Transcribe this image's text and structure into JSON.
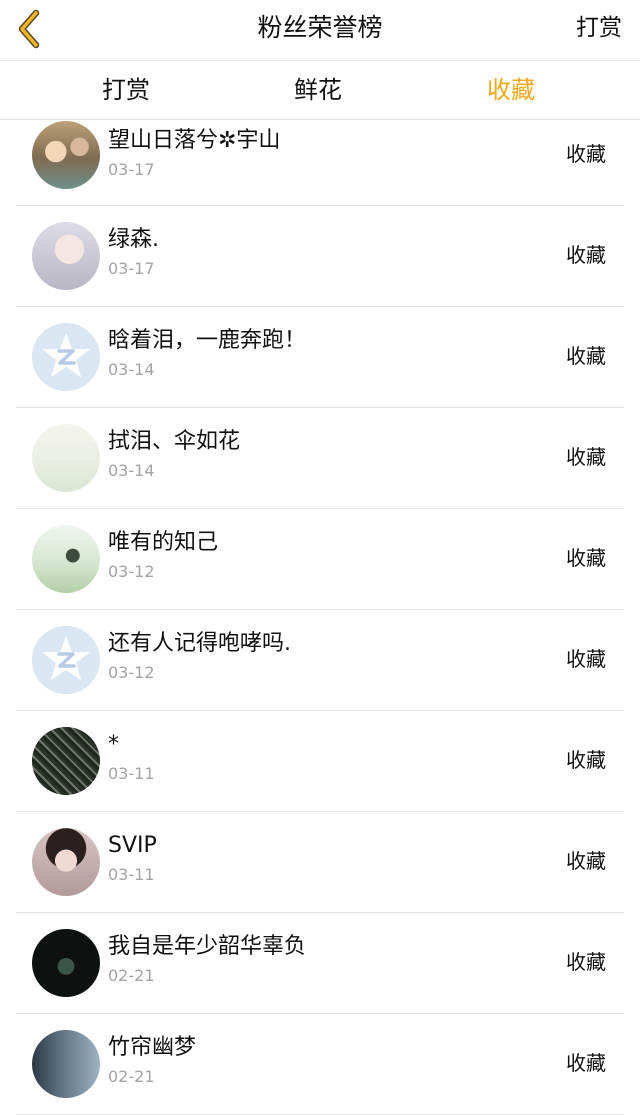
{
  "header": {
    "title": "粉丝荣誉榜",
    "action_label": "打赏",
    "back_icon": "chevron-left-icon"
  },
  "tabs": [
    {
      "label": "打赏",
      "active": false
    },
    {
      "label": "鲜花",
      "active": false
    },
    {
      "label": "收藏",
      "active": true
    }
  ],
  "colors": {
    "accent": "#f0a81e",
    "text": "#111111",
    "muted": "#a3a3a3",
    "divider": "#e3e3e3"
  },
  "list": [
    {
      "name": "望山日落兮✲宇山",
      "date": "03-17",
      "action": "收藏"
    },
    {
      "name": "绿森.",
      "date": "03-17",
      "action": "收藏"
    },
    {
      "name": "晗着泪，一鹿奔跑！",
      "date": "03-14",
      "action": "收藏"
    },
    {
      "name": "拭泪、伞如花",
      "date": "03-14",
      "action": "收藏"
    },
    {
      "name": "唯有的知己",
      "date": "03-12",
      "action": "收藏"
    },
    {
      "name": "还有人记得咆哮吗.",
      "date": "03-12",
      "action": "收藏"
    },
    {
      "name": "*",
      "date": "03-11",
      "action": "收藏"
    },
    {
      "name": "SVIP",
      "date": "03-11",
      "action": "收藏"
    },
    {
      "name": "我自是年少韶华辜负",
      "date": "02-21",
      "action": "收藏"
    },
    {
      "name": "竹帘幽梦",
      "date": "02-21",
      "action": "收藏"
    }
  ]
}
